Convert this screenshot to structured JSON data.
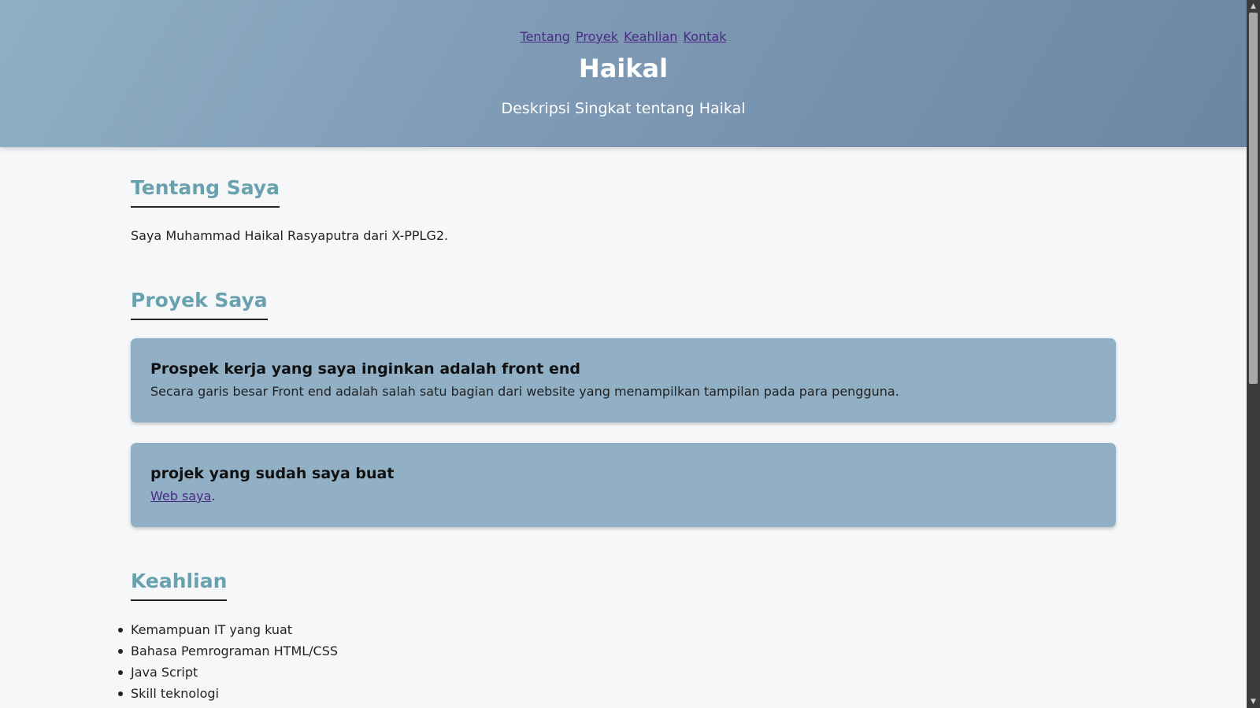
{
  "nav": {
    "links": [
      "Tentang",
      "Proyek",
      "Keahlian",
      "Kontak"
    ]
  },
  "header": {
    "title": "Haikal",
    "subtitle": "Deskripsi Singkat tentang Haikal"
  },
  "about": {
    "heading": "Tentang Saya",
    "text": "Saya Muhammad Haikal Rasyaputra dari X-PPLG2."
  },
  "projects": {
    "heading": "Proyek Saya",
    "cards": [
      {
        "title": "Prospek kerja yang saya inginkan adalah front end",
        "text": "Secara garis besar Front end adalah salah satu bagian dari website yang menampilkan tampilan pada para pengguna."
      },
      {
        "title": "projek yang sudah saya buat",
        "link_text": "Web saya",
        "after_link": "."
      }
    ]
  },
  "skills": {
    "heading": "Keahlian",
    "items": [
      "Kemampuan IT yang kuat",
      "Bahasa Pemrograman HTML/CSS",
      "Java Script",
      "Skill teknologi"
    ]
  },
  "scrollbar": {
    "up_icon": "▲",
    "down_icon": "▼"
  },
  "colors": {
    "header_gradient_start": "#8fb0c6",
    "header_gradient_end": "#6d86a3",
    "heading_accent": "#6aa1ae",
    "card_background": "#91b0c6",
    "link": "#4b2a86",
    "page_background": "#f6f7f9"
  }
}
